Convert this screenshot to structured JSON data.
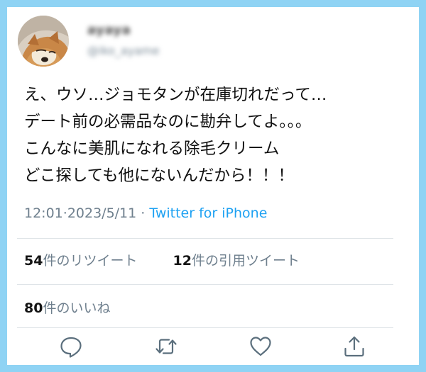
{
  "user": {
    "display_name": "ayaya",
    "username": "@iko_ayame"
  },
  "tweet": {
    "lines": [
      "え、ウソ…ジョモタンが在庫切れだって…",
      "デート前の必需品なのに勘弁してよ。。。",
      "こんなに美肌になれる除毛クリーム",
      "どこ探しても他にないんだから！！！"
    ]
  },
  "meta": {
    "time": "12:01",
    "date": "2023/5/11",
    "separator": "·",
    "source": "Twitter for iPhone"
  },
  "stats": {
    "retweets_count": "54",
    "retweets_label": "件のリツイート",
    "quotes_count": "12",
    "quotes_label": "件の引用ツイート",
    "likes_count": "80",
    "likes_label": "件のいいね"
  },
  "actions": [
    {
      "icon": "reply-icon"
    },
    {
      "icon": "retweet-icon"
    },
    {
      "icon": "heart-icon"
    },
    {
      "icon": "share-icon"
    }
  ],
  "colors": {
    "frame": "#8fd3f4",
    "link": "#1da1f2",
    "secondary_text": "#6e7f8d",
    "divider": "#dfe4e8"
  }
}
